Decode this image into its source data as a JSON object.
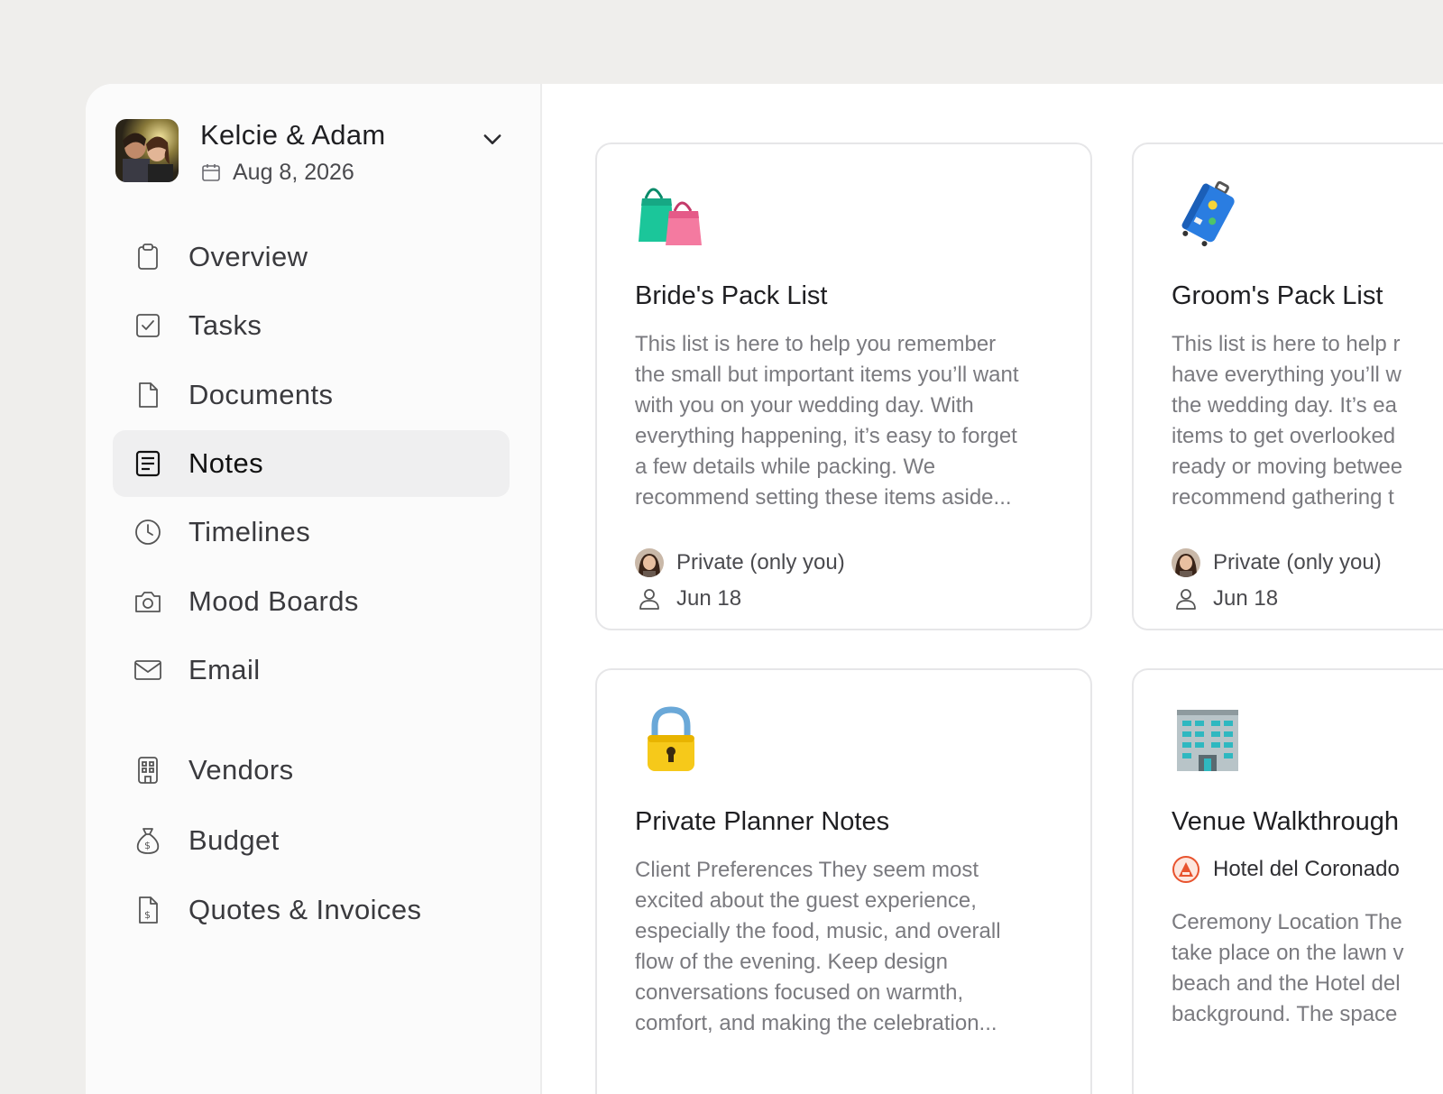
{
  "profile": {
    "couple_name": "Kelcie & Adam",
    "wedding_date": "Aug 8, 2026"
  },
  "nav": {
    "items": [
      {
        "label": "Overview",
        "icon": "clipboard-icon"
      },
      {
        "label": "Tasks",
        "icon": "checkbox-icon"
      },
      {
        "label": "Documents",
        "icon": "document-icon"
      },
      {
        "label": "Notes",
        "icon": "notes-icon",
        "active": true
      },
      {
        "label": "Timelines",
        "icon": "clock-icon"
      },
      {
        "label": "Mood Boards",
        "icon": "camera-icon"
      },
      {
        "label": "Email",
        "icon": "envelope-icon"
      }
    ],
    "secondary_items": [
      {
        "label": "Vendors",
        "icon": "building-icon"
      },
      {
        "label": "Budget",
        "icon": "money-bag-icon"
      },
      {
        "label": "Quotes & Invoices",
        "icon": "invoice-icon"
      }
    ]
  },
  "notes": [
    {
      "emoji": "shopping-bags-icon",
      "title": "Bride's Pack List",
      "body": "This list is here to help you remember\nthe small but important items you’ll want\nwith you on your wedding day. With\neverything happening, it’s easy to forget\na few details while packing. We\nrecommend setting these items aside...",
      "visibility": "Private (only you)",
      "date": "Jun 18"
    },
    {
      "emoji": "luggage-icon",
      "title": "Groom's Pack List",
      "body": "This list is here to help r\nhave everything you’ll w\nthe wedding day. It’s ea\nitems to get overlooked\nready or moving betwee\nrecommend gathering t",
      "visibility": "Private (only you)",
      "date": "Jun 18"
    },
    {
      "emoji": "padlock-icon",
      "title": "Private Planner Notes",
      "body": "Client Preferences They seem most\nexcited about the guest experience,\nespecially the food, music, and overall\nflow of the evening. Keep design\nconversations focused on warmth,\ncomfort, and making the celebration..."
    },
    {
      "emoji": "hotel-icon",
      "title": "Venue Walkthrough",
      "venue": "Hotel del Coronado",
      "body": "Ceremony Location The\ntake place on the lawn v\nbeach and the Hotel del\nbackground. The space"
    }
  ]
}
